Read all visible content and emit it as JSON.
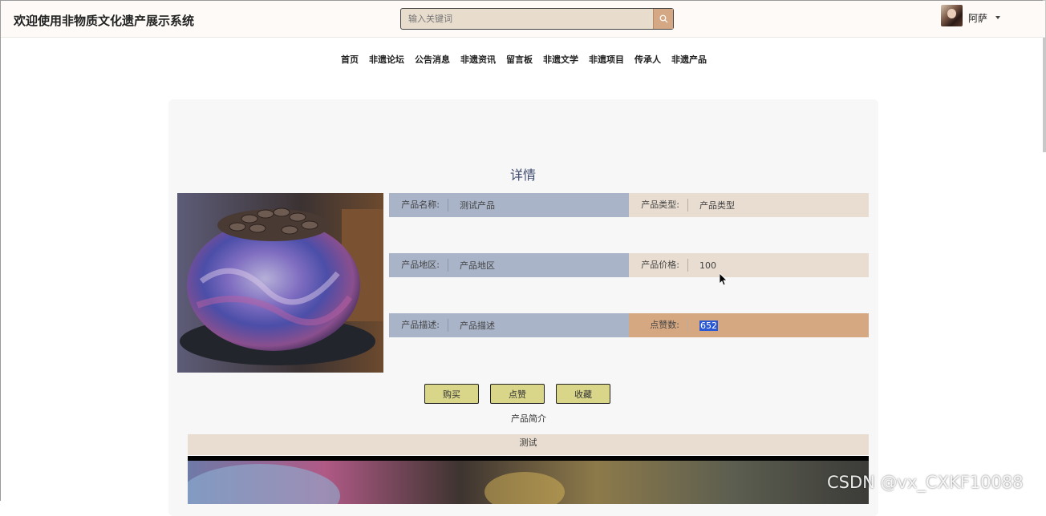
{
  "header": {
    "site_title": "欢迎使用非物质文化遗产展示系统",
    "search_placeholder": "输入关键词",
    "search_icon": "search-icon",
    "username": "阿萨"
  },
  "nav": {
    "items": [
      "首页",
      "非遗论坛",
      "公告消息",
      "非遗资讯",
      "留言板",
      "非遗文学",
      "非遗项目",
      "传承人",
      "非遗产品"
    ]
  },
  "detail": {
    "title": "详情",
    "fields": {
      "name_label": "产品名称:",
      "name_value": "测试产品",
      "type_label": "产品类型:",
      "type_value": "产品类型",
      "region_label": "产品地区:",
      "region_value": "产品地区",
      "price_label": "产品价格:",
      "price_value": "100",
      "desc_label": "产品描述:",
      "desc_value": "产品描述",
      "likes_label": "点赞数:",
      "likes_value": "652"
    },
    "buttons": {
      "buy": "购买",
      "like": "点赞",
      "favorite": "收藏"
    },
    "intro_label": "产品简介",
    "intro_text": "测试"
  },
  "watermark": "CSDN @vx_CXKF10088",
  "colors": {
    "accent_left": "#a9b4c8",
    "accent_right": "#e8ddd0",
    "likes_highlight": "#d6a882",
    "button": "#d9d68a"
  }
}
